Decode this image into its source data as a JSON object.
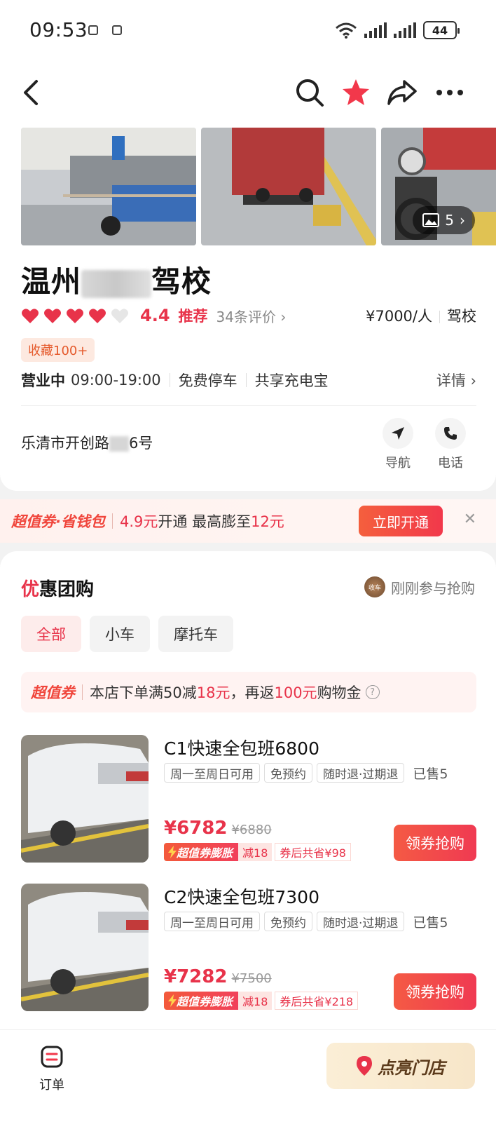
{
  "status_bar": {
    "time": "09:53",
    "battery": "44"
  },
  "shop": {
    "name_prefix": "温州",
    "name_suffix": "驾校",
    "rating": "4.4",
    "recommend_label": "推荐",
    "reviews": "34条评价",
    "price_per_person": "¥7000/人",
    "category": "驾校",
    "favorites_badge": "收藏100+",
    "status": "营业中",
    "hours": "09:00-19:00",
    "amenities": [
      "免费停车",
      "共享充电宝"
    ],
    "details_label": "详情",
    "address_prefix": "乐清市开创路",
    "address_suffix": "6号",
    "navigate_label": "导航",
    "phone_label": "电话",
    "photo_count": "5",
    "hearts_filled": 4,
    "hearts_total": 5
  },
  "promo": {
    "brand": "超值券·省钱包",
    "price": "4.9元",
    "text_mid": "开通 最高膨至",
    "max": "12元",
    "button": "立即开通"
  },
  "deals_section": {
    "title_first": "优",
    "title_rest": "惠团购",
    "just_joined": "刚刚参与抢购",
    "avatar_text": "收车",
    "filters": [
      "全部",
      "小车",
      "摩托车"
    ],
    "coupon_brand": "超值券",
    "coupon_text_1": "本店下单满50减",
    "coupon_amount": "18元",
    "coupon_text_2": "，再返",
    "coupon_cashback": "100元",
    "coupon_text_3": "购物金",
    "items": [
      {
        "title": "C1快速全包班6800",
        "tags": [
          "周一至周日可用",
          "免预约",
          "随时退·过期退"
        ],
        "sold": "已售5",
        "price": "¥6782",
        "original": "¥6880",
        "boost_label": "超值券膨胀",
        "boost_amount": "减18",
        "total_save": "券后共省¥98",
        "button": "领券抢购"
      },
      {
        "title": "C2快速全包班7300",
        "tags": [
          "周一至周日可用",
          "免预约",
          "随时退·过期退"
        ],
        "sold": "已售5",
        "price": "¥7282",
        "original": "¥7500",
        "boost_label": "超值券膨胀",
        "boost_amount": "减18",
        "total_save": "券后共省¥218",
        "button": "领券抢购"
      }
    ]
  },
  "bottom_bar": {
    "orders_label": "订单",
    "light_up_label": "点亮门店"
  },
  "colors": {
    "accent": "#e8334a",
    "promo_orange": "#f0463c"
  }
}
